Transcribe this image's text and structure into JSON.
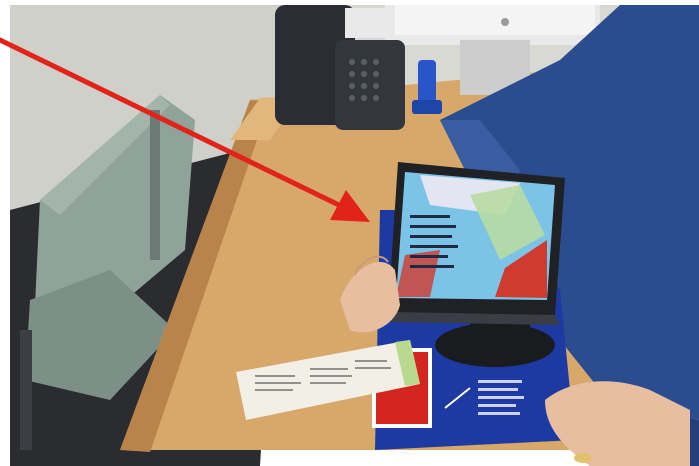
{
  "scene": {
    "palette": {
      "wall": "#d9d9d4",
      "desk": "#d8a86a",
      "desk_shadow": "#b98449",
      "floor": "#2a2c30",
      "chair": "#8fa39a",
      "sweater": "#2b4c8e",
      "tablet_bezel": "#1f2125",
      "tablet_screen": "#7cc3e8",
      "mat": "#1d3aa3",
      "mat_square": "#d3261f",
      "arrow": "#e2231a",
      "skin": "#e7bfa0",
      "ticket": "#f2efe6",
      "phone": "#2a2d33"
    },
    "icons": {
      "pointer": "arrow-icon",
      "phone": "desk-phone-icon"
    }
  }
}
